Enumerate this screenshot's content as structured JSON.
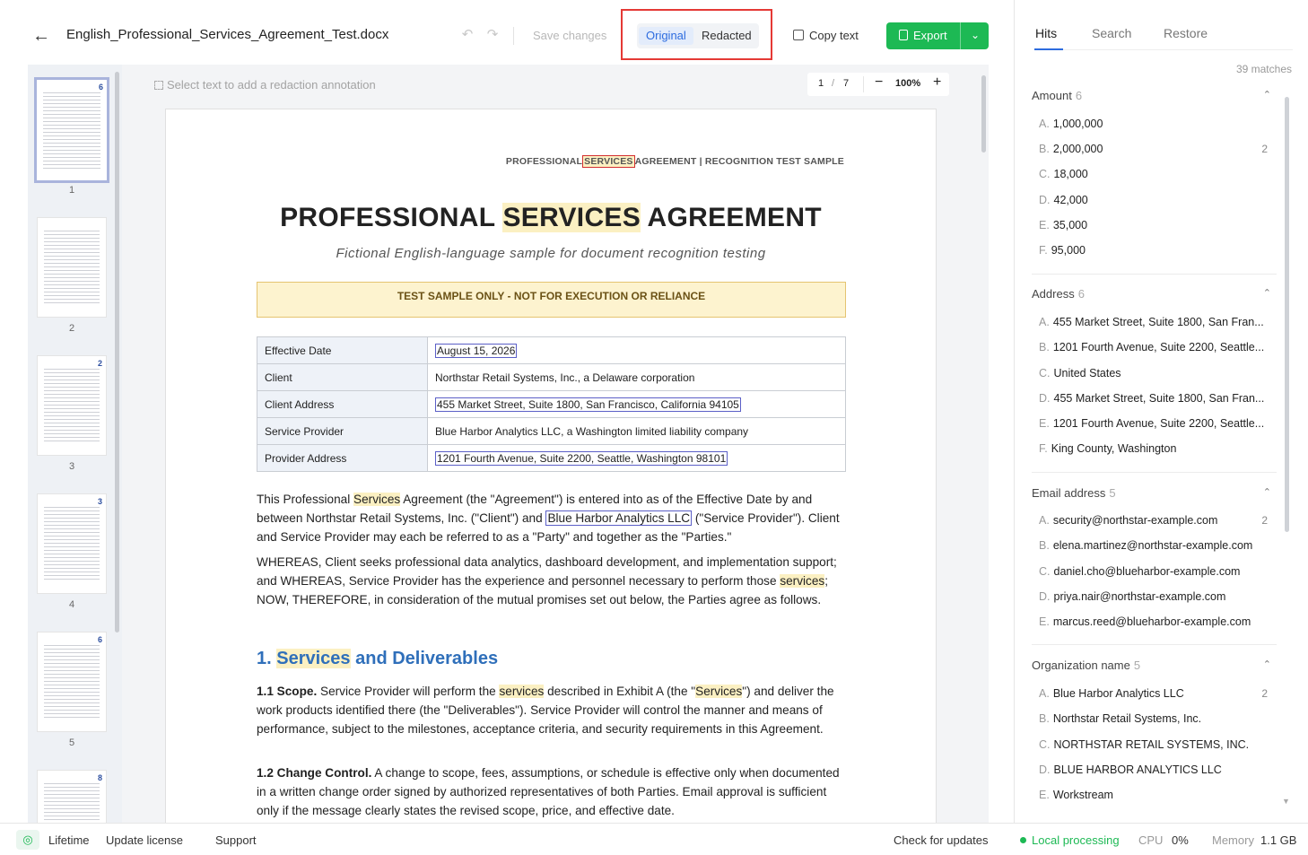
{
  "toolbar": {
    "filename": "English_Professional_Services_Agreement_Test.docx",
    "save_label": "Save changes",
    "view_original": "Original",
    "view_redacted": "Redacted",
    "copy_text": "Copy text",
    "export_label": "Export"
  },
  "thumbnails": [
    {
      "page": "1",
      "badge": "6",
      "active": true
    },
    {
      "page": "2",
      "badge": "",
      "active": false
    },
    {
      "page": "3",
      "badge": "2",
      "active": false
    },
    {
      "page": "4",
      "badge": "3",
      "active": false
    },
    {
      "page": "5",
      "badge": "6",
      "active": false
    },
    {
      "page": "",
      "badge": "8",
      "active": false
    }
  ],
  "viewer": {
    "hint": "Select text to add a redaction annotation",
    "page_current": "1",
    "page_sep": "/",
    "page_total": "7",
    "zoom": "100%"
  },
  "document": {
    "header_pre": "PROFESSIONAL",
    "header_hit": "SERVICES",
    "header_post": "AGREEMENT  |  RECOGNITION TEST SAMPLE",
    "title_pre": "PROFESSIONAL ",
    "title_hit": "SERVICES",
    "title_post": " AGREEMENT",
    "subtitle": "Fictional English-language sample for document recognition testing",
    "banner": "TEST SAMPLE ONLY - NOT FOR EXECUTION OR RELIANCE",
    "table": {
      "effective_date_k": "Effective Date",
      "effective_date_v": "August 15, 2026",
      "client_k": "Client",
      "client_v": "Northstar Retail Systems, Inc., a Delaware corporation",
      "client_address_k": "Client Address",
      "client_address_v": "455 Market Street, Suite 1800, San Francisco, California 94105",
      "provider_k": "Service Provider",
      "provider_v": "Blue Harbor Analytics LLC, a Washington limited liability company",
      "provider_address_k": "Provider Address",
      "provider_address_v": "1201 Fourth Avenue, Suite 2200, Seattle, Washington 98101"
    },
    "p1_a": "This Professional ",
    "p1_hit": "Services",
    "p1_b": " Agreement (the \"Agreement\") is entered into as of the Effective Date by and between Northstar Retail Systems, Inc. (\"Client\") and ",
    "p1_org": "Blue Harbor Analytics LLC",
    "p1_c": " (\"Service Provider\"). Client and Service Provider may each be referred to as a \"Party\" and together as the \"Parties.\"",
    "p2_a": "WHEREAS, Client seeks professional data analytics, dashboard development, and implementation support; and WHEREAS, Service Provider has the experience and personnel necessary to perform those ",
    "p2_hit": "services",
    "p2_b": "; NOW, THEREFORE, in consideration of the mutual promises set out below, the Parties agree as follows.",
    "h1_num": "1. ",
    "h1_hit": "Services",
    "h1_rest": " and Deliverables",
    "s11_label": "1.1 Scope.",
    "s11_a": " Service Provider will perform the ",
    "s11_hit1": "services",
    "s11_b": " described in Exhibit A (the \"",
    "s11_hit2": "Services",
    "s11_c": "\") and deliver the work products identified there (the \"Deliverables\"). Service Provider will control the manner and means of performance, subject to the milestones, acceptance criteria, and security requirements in this Agreement.",
    "s12_label": "1.2 Change Control.",
    "s12_text": " A change to scope, fees, assumptions, or schedule is effective only when documented in a written change order signed by authorized representatives of both Parties. Email approval is sufficient only if the message clearly states the revised scope, price, and effective date."
  },
  "panel": {
    "tabs": [
      "Hits",
      "Search",
      "Restore"
    ],
    "matches": "39 matches",
    "groups": [
      {
        "name": "Amount",
        "count": "6",
        "items": [
          {
            "l": "A.",
            "t": "1,000,000",
            "n": ""
          },
          {
            "l": "B.",
            "t": "2,000,000",
            "n": "2"
          },
          {
            "l": "C.",
            "t": "18,000",
            "n": ""
          },
          {
            "l": "D.",
            "t": "42,000",
            "n": ""
          },
          {
            "l": "E.",
            "t": "35,000",
            "n": ""
          },
          {
            "l": "F.",
            "t": "95,000",
            "n": ""
          }
        ]
      },
      {
        "name": "Address",
        "count": "6",
        "items": [
          {
            "l": "A.",
            "t": "455 Market Street, Suite 1800, San Fran...",
            "n": ""
          },
          {
            "l": "B.",
            "t": "1201 Fourth Avenue, Suite 2200, Seattle...",
            "n": ""
          },
          {
            "l": "C.",
            "t": "United States",
            "n": ""
          },
          {
            "l": "D.",
            "t": "455 Market Street, Suite 1800, San Fran...",
            "n": ""
          },
          {
            "l": "E.",
            "t": "1201 Fourth Avenue, Suite 2200, Seattle...",
            "n": ""
          },
          {
            "l": "F.",
            "t": "King County, Washington",
            "n": ""
          }
        ]
      },
      {
        "name": "Email address",
        "count": "5",
        "items": [
          {
            "l": "A.",
            "t": "security@northstar-example.com",
            "n": "2"
          },
          {
            "l": "B.",
            "t": "elena.martinez@northstar-example.com",
            "n": ""
          },
          {
            "l": "C.",
            "t": "daniel.cho@blueharbor-example.com",
            "n": ""
          },
          {
            "l": "D.",
            "t": "priya.nair@northstar-example.com",
            "n": ""
          },
          {
            "l": "E.",
            "t": "marcus.reed@blueharbor-example.com",
            "n": ""
          }
        ]
      },
      {
        "name": "Organization name",
        "count": "5",
        "items": [
          {
            "l": "A.",
            "t": "Blue Harbor Analytics LLC",
            "n": "2"
          },
          {
            "l": "B.",
            "t": "Northstar Retail Systems, Inc.",
            "n": ""
          },
          {
            "l": "C.",
            "t": "NORTHSTAR RETAIL SYSTEMS, INC.",
            "n": ""
          },
          {
            "l": "D.",
            "t": "BLUE HARBOR ANALYTICS LLC",
            "n": ""
          },
          {
            "l": "E.",
            "t": "Workstream",
            "n": ""
          }
        ]
      }
    ]
  },
  "statusbar": {
    "lifetime": "Lifetime",
    "update_license": "Update license",
    "support": "Support",
    "check_updates": "Check for updates",
    "local_processing": "Local processing",
    "cpu_label": "CPU",
    "cpu_value": "0%",
    "memory_label": "Memory",
    "memory_value": "1.1 GB"
  },
  "colors": {
    "accent": "#2d6cdf",
    "export_green": "#1db954",
    "highlight": "#fbf0c2",
    "annotation_box": "#5b5fc7",
    "callout_red": "#e53935"
  }
}
